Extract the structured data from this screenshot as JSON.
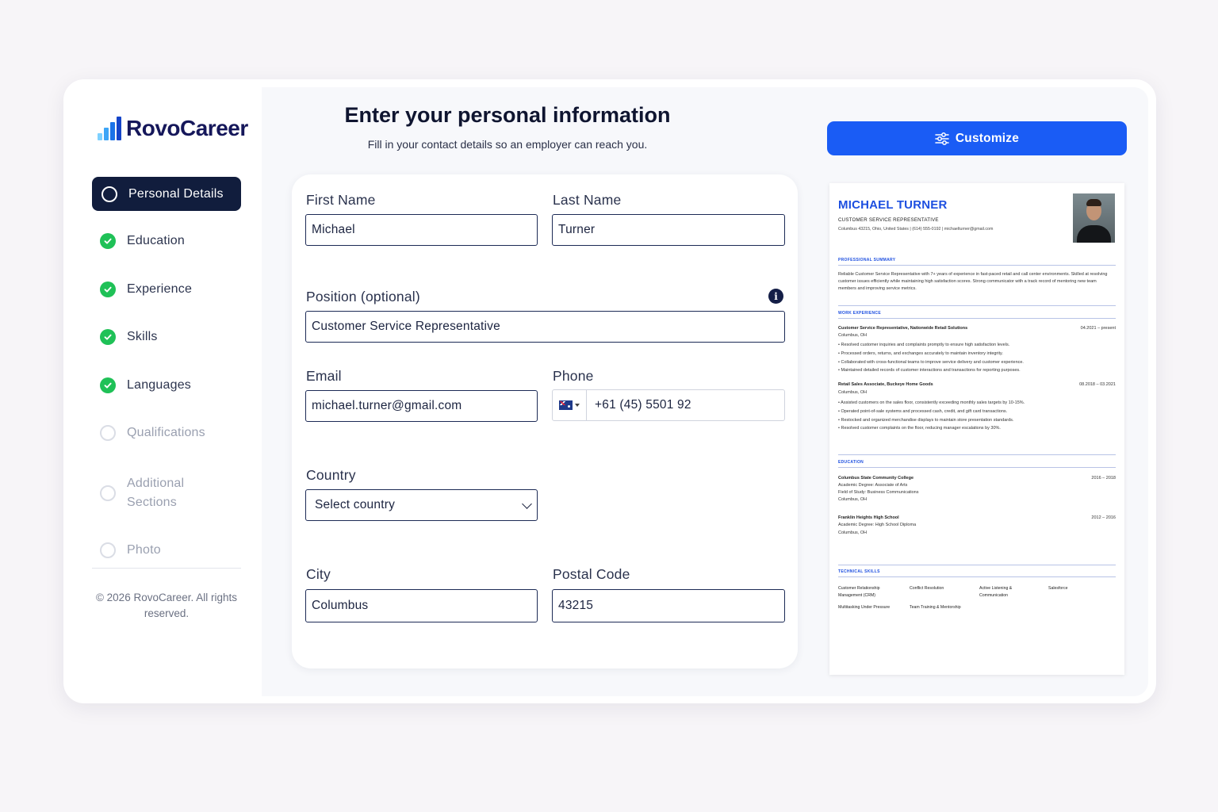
{
  "brand": {
    "name": "RovoCareer",
    "bar_colors": [
      "#7ed1ff",
      "#3da5f6",
      "#1b73e8",
      "#1545c9"
    ]
  },
  "sidebar": {
    "steps": [
      {
        "label": "Personal Details",
        "state": "active"
      },
      {
        "label": "Education",
        "state": "done"
      },
      {
        "label": "Experience",
        "state": "done"
      },
      {
        "label": "Skills",
        "state": "done"
      },
      {
        "label": "Languages",
        "state": "done"
      },
      {
        "label": "Qualifications",
        "state": "todo"
      },
      {
        "label": "Additional Sections",
        "state": "todo"
      },
      {
        "label": "Photo",
        "state": "todo"
      }
    ],
    "copyright": "© 2026 RovoCareer. All rights reserved."
  },
  "header": {
    "title": "Enter your personal information",
    "subtitle": "Fill in your contact details so an employer can reach you."
  },
  "form": {
    "first_name": {
      "label": "First Name",
      "value": "Michael"
    },
    "last_name": {
      "label": "Last Name",
      "value": "Turner"
    },
    "position": {
      "label": "Position (optional)",
      "value": "Customer Service Representative",
      "info_icon": "info-icon"
    },
    "email": {
      "label": "Email",
      "value": "michael.turner@gmail.com"
    },
    "phone": {
      "label": "Phone",
      "value": "+61 (45) 5501 92",
      "flag": "australia-flag"
    },
    "country": {
      "label": "Country",
      "value": "Select country"
    },
    "city": {
      "label": "City",
      "value": "Columbus"
    },
    "postal_code": {
      "label": "Postal Code",
      "value": "43215"
    }
  },
  "customize_button": {
    "label": "Customize",
    "icon": "sliders-icon"
  },
  "colors": {
    "accent": "#1a5cf5",
    "sidebar_active": "#111d3d",
    "check": "#1fc157",
    "resume_heading": "#1d4fe0"
  },
  "resume": {
    "name": "MICHAEL TURNER",
    "role": "CUSTOMER SERVICE REPRESENTATIVE",
    "contact": "Columbus 43215, Ohio, United States | (614) 555-0192 | michaelturner@gmail.com",
    "summary_heading": "PROFESSIONAL SUMMARY",
    "summary": "Reliable Customer Service Representative with 7+ years of experience in fast-paced retail and call center environments. Skilled at resolving customer issues efficiently while maintaining high satisfaction scores. Strong communicator with a track record of mentoring new team members and improving service metrics.",
    "work_heading": "WORK EXPERIENCE",
    "jobs": [
      {
        "title": "Customer Service Representative, Nationwide Retail Solutions",
        "dates": "04.2021 – present",
        "location": "Columbus, OH",
        "bullets": [
          "Resolved customer inquiries and complaints promptly to ensure high satisfaction levels.",
          "Processed orders, returns, and exchanges accurately to maintain inventory integrity.",
          "Collaborated with cross-functional teams to improve service delivery and customer experience.",
          "Maintained detailed records of customer interactions and transactions for reporting purposes."
        ]
      },
      {
        "title": "Retail Sales Associate, Buckeye Home Goods",
        "dates": "08.2018 – 03.2021",
        "location": "Columbus, OH",
        "bullets": [
          "Assisted customers on the sales floor, consistently exceeding monthly sales targets by 10-15%.",
          "Operated point-of-sale systems and processed cash, credit, and gift card transactions.",
          "Restocked and organized merchandise displays to maintain store presentation standards.",
          "Resolved customer complaints on the floor, reducing manager escalations by 30%."
        ]
      }
    ],
    "education_heading": "EDUCATION",
    "education": [
      {
        "school": "Columbus State Community College",
        "dates": "2016 – 2018",
        "degree": "Academic Degree: Associate of Arts",
        "field": "Field of Study: Business Communications",
        "location": "Columbus, OH"
      },
      {
        "school": "Franklin Heights High School",
        "dates": "2012 – 2016",
        "degree": "Academic Degree: High School Diploma",
        "location": "Columbus, OH"
      }
    ],
    "skills_heading": "TECHNICAL SKILLS",
    "skills": [
      "Customer Relationship Management (CRM)",
      "Conflict Resolution",
      "Active Listening & Communication",
      "Salesforce",
      "Multitasking Under Pressure",
      "Team Training & Mentorship"
    ]
  }
}
